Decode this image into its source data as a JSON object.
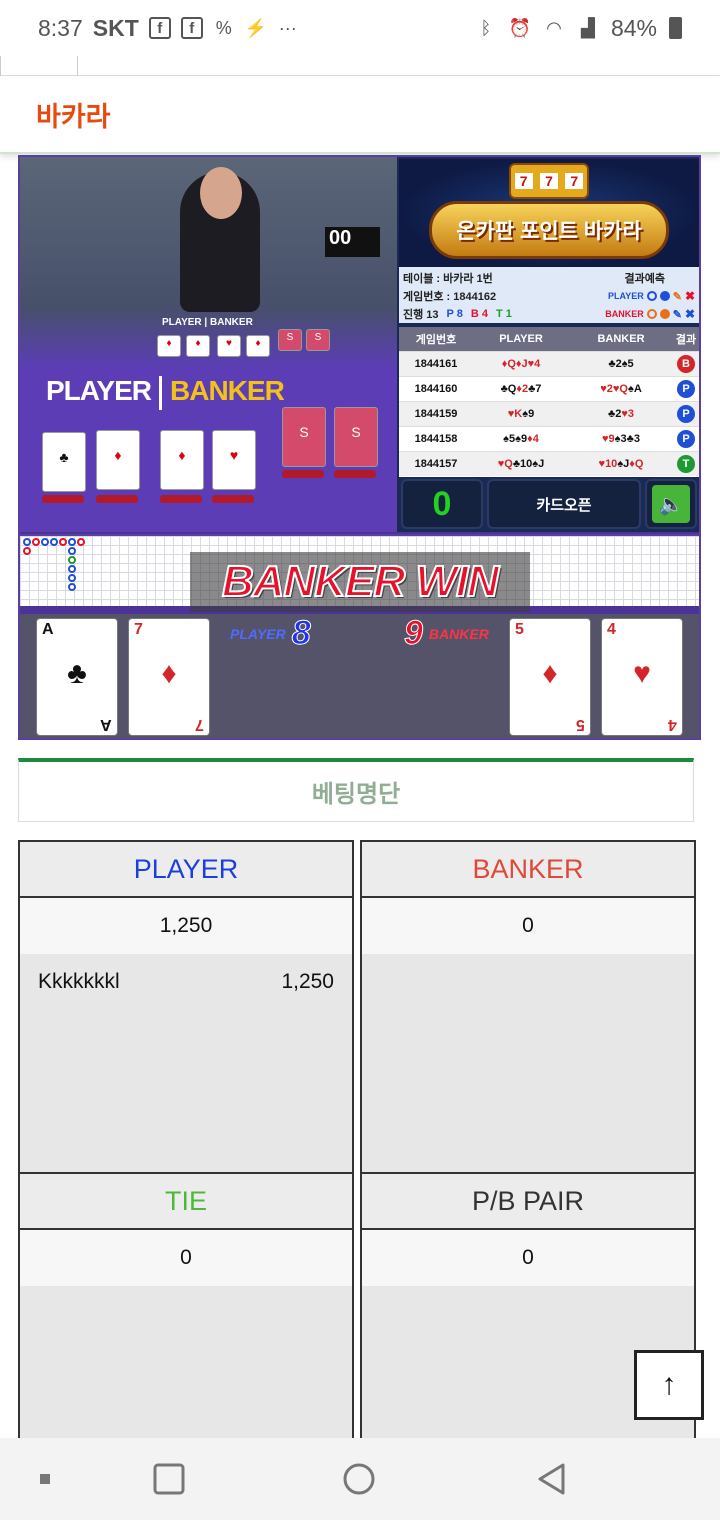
{
  "status_bar": {
    "time": "8:37",
    "carrier": "SKT",
    "battery": "84%"
  },
  "header": {
    "title": "바카라"
  },
  "game": {
    "video": {
      "table_label_player": "PLAYER",
      "table_label_banker": "BANKER",
      "monitor_text": "00"
    },
    "banner_title": "온카판 포인트 바카라",
    "slot_symbols": [
      "7",
      "7",
      "7"
    ],
    "info": {
      "table": "테이블 : 바카라 1번",
      "prediction_label": "결과예측",
      "game_number": "게임번호 : 1844162",
      "progress": "진행 13",
      "p_count": "P 8",
      "b_count": "B 4",
      "t_count": "T 1",
      "player_label": "PLAYER",
      "banker_label": "BANKER"
    },
    "history": {
      "headers": [
        "게임번호",
        "PLAYER",
        "BANKER",
        "결과"
      ],
      "rows": [
        {
          "id": "1844161",
          "player": [
            {
              "t": "♦Q",
              "c": "r"
            },
            {
              "t": "♦J",
              "c": "r"
            },
            {
              "t": "♥4",
              "c": "r"
            }
          ],
          "banker": [
            {
              "t": "♣2",
              "c": "k"
            },
            {
              "t": "♠5",
              "c": "k"
            }
          ],
          "result": "B"
        },
        {
          "id": "1844160",
          "player": [
            {
              "t": "♣Q",
              "c": "k"
            },
            {
              "t": "♦2",
              "c": "r"
            },
            {
              "t": "♣7",
              "c": "k"
            }
          ],
          "banker": [
            {
              "t": "♥2",
              "c": "r"
            },
            {
              "t": "♥Q",
              "c": "r"
            },
            {
              "t": "♠A",
              "c": "k"
            }
          ],
          "result": "P"
        },
        {
          "id": "1844159",
          "player": [
            {
              "t": "♥K",
              "c": "r"
            },
            {
              "t": "♠9",
              "c": "k"
            }
          ],
          "banker": [
            {
              "t": "♣2",
              "c": "k"
            },
            {
              "t": "♥3",
              "c": "r"
            }
          ],
          "result": "P"
        },
        {
          "id": "1844158",
          "player": [
            {
              "t": "♠5",
              "c": "k"
            },
            {
              "t": "♠9",
              "c": "k"
            },
            {
              "t": "♦4",
              "c": "r"
            }
          ],
          "banker": [
            {
              "t": "♥9",
              "c": "r"
            },
            {
              "t": "♠3",
              "c": "k"
            },
            {
              "t": "♣3",
              "c": "k"
            }
          ],
          "result": "P"
        },
        {
          "id": "1844157",
          "player": [
            {
              "t": "♥Q",
              "c": "r"
            },
            {
              "t": "♣10",
              "c": "k"
            },
            {
              "t": "♠J",
              "c": "k"
            }
          ],
          "banker": [
            {
              "t": "♥10",
              "c": "r"
            },
            {
              "t": "♠J",
              "c": "k"
            },
            {
              "t": "♦Q",
              "c": "r"
            }
          ],
          "result": "T"
        }
      ]
    },
    "controls": {
      "count": "0",
      "card_open": "카드오픈",
      "sound_icon": "speaker-icon"
    },
    "result_banner": "BANKER WIN",
    "player_score_label": "PLAYER",
    "player_score": "8",
    "banker_score_label": "BANKER",
    "banker_score": "9",
    "player_cards": [
      {
        "rank": "A",
        "suit": "♣",
        "color": "black"
      },
      {
        "rank": "7",
        "suit": "♦",
        "color": "red"
      }
    ],
    "banker_cards": [
      {
        "rank": "5",
        "suit": "♦",
        "color": "red"
      },
      {
        "rank": "4",
        "suit": "♥",
        "color": "red"
      }
    ]
  },
  "betting": {
    "title": "베팅명단",
    "player": {
      "label": "PLAYER",
      "total": "1,250",
      "entries": [
        {
          "name": "Kkkkkkkl",
          "amount": "1,250"
        }
      ]
    },
    "banker": {
      "label": "BANKER",
      "total": "0"
    },
    "tie": {
      "label": "TIE",
      "total": "0"
    },
    "pair": {
      "label": "P/B PAIR",
      "total": "0"
    }
  },
  "colors": {
    "title_orange": "#e8490f",
    "player_blue": "#1b3fe0",
    "banker_red": "#e0493a",
    "tie_green": "#4db83a",
    "accent_green": "#1e8a3c"
  }
}
